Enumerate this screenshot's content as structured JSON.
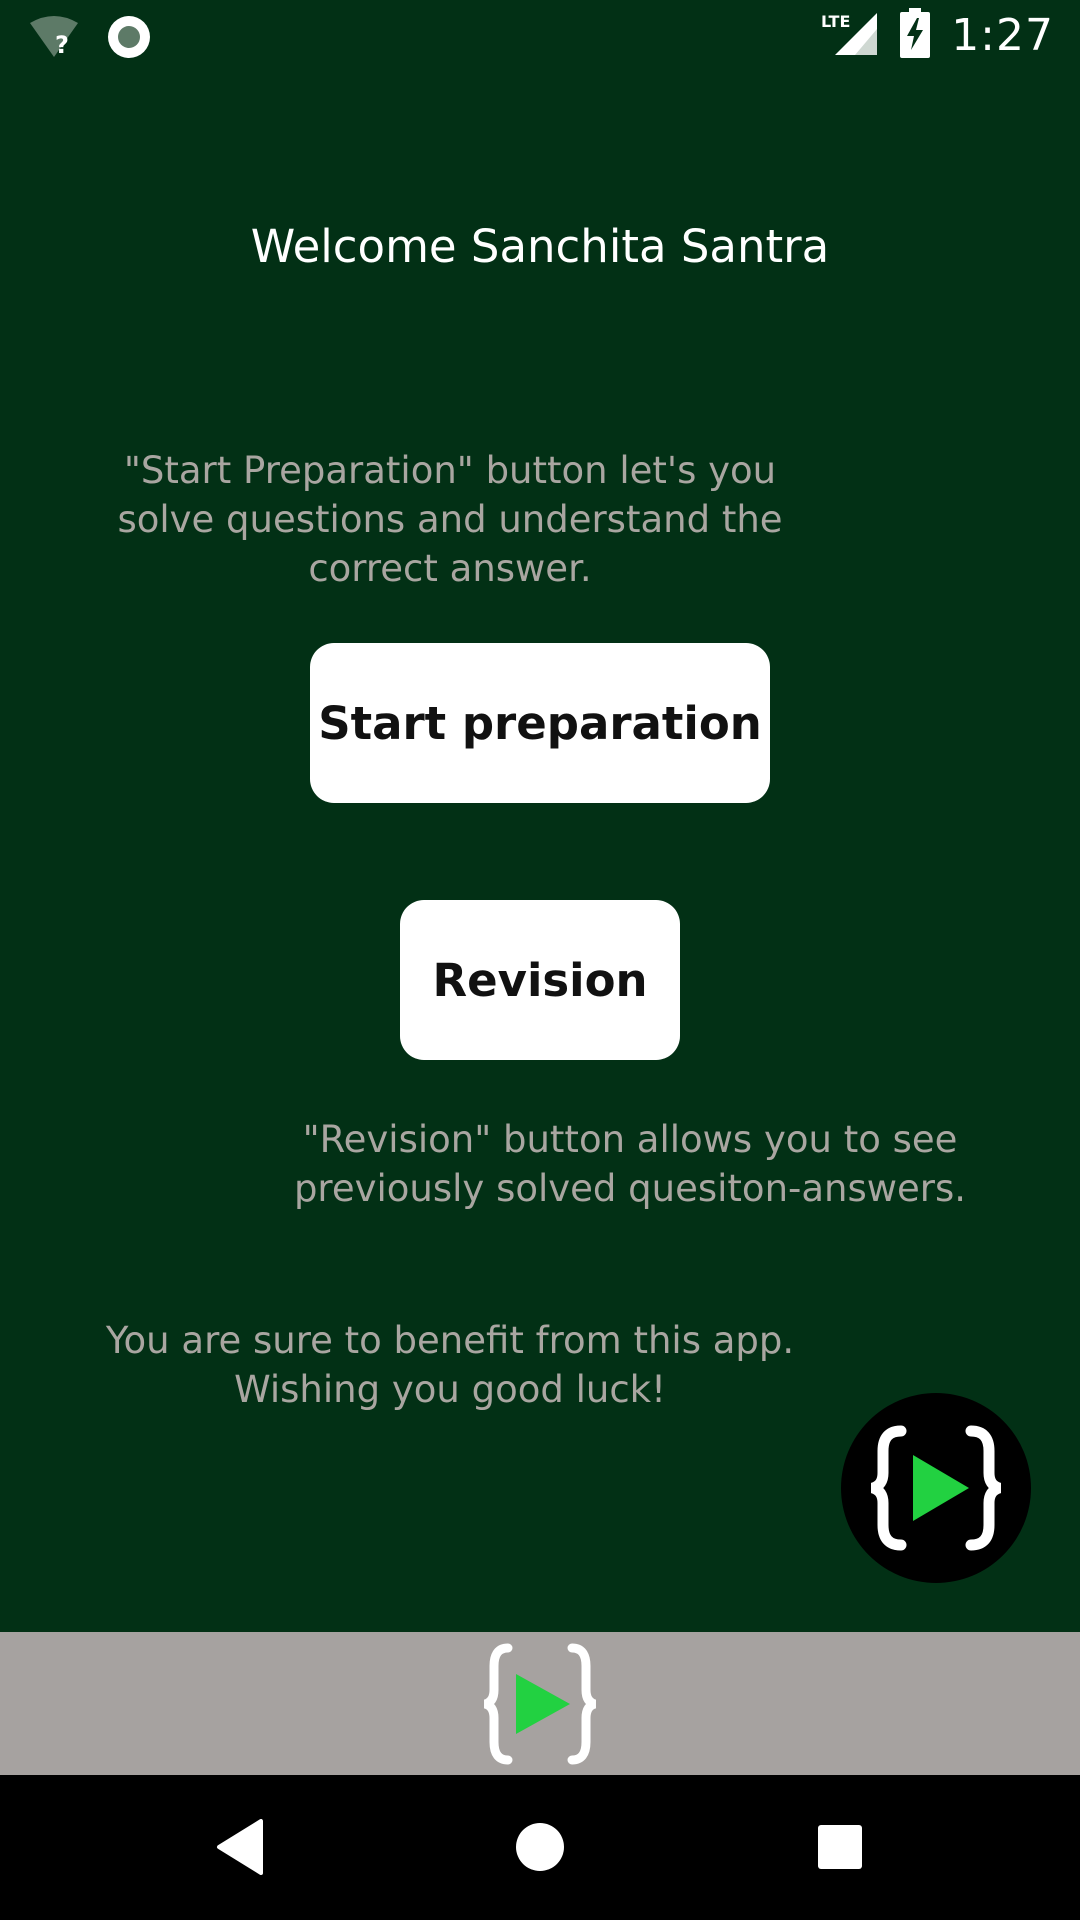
{
  "status_bar": {
    "time": "1:27",
    "network_label": "LTE",
    "icons": [
      "wifi-question-icon",
      "record-icon",
      "lte-signal-icon",
      "battery-charging-icon"
    ]
  },
  "main": {
    "welcome_text": "Welcome Sanchita Santra",
    "prep_description": "\"Start Preparation\" button let's you solve questions and understand the correct answer.",
    "start_button_label": "Start preparation",
    "revision_button_label": "Revision",
    "revision_description": "\"Revision\" button allows you to see previously solved quesiton-answers.",
    "closing_text": "You are sure to benefit from this app. Wishing you good luck!",
    "fab_icon": "code-play-icon"
  },
  "banner": {
    "icon": "code-play-logo-icon"
  },
  "navbar": {
    "icons": [
      "back-icon",
      "home-icon",
      "recents-icon"
    ]
  },
  "colors": {
    "background": "#023015",
    "button_bg": "#ffffff",
    "description_text": "#a9a6a1",
    "banner_bg": "#a6a2a0",
    "play_green": "#22d141"
  }
}
